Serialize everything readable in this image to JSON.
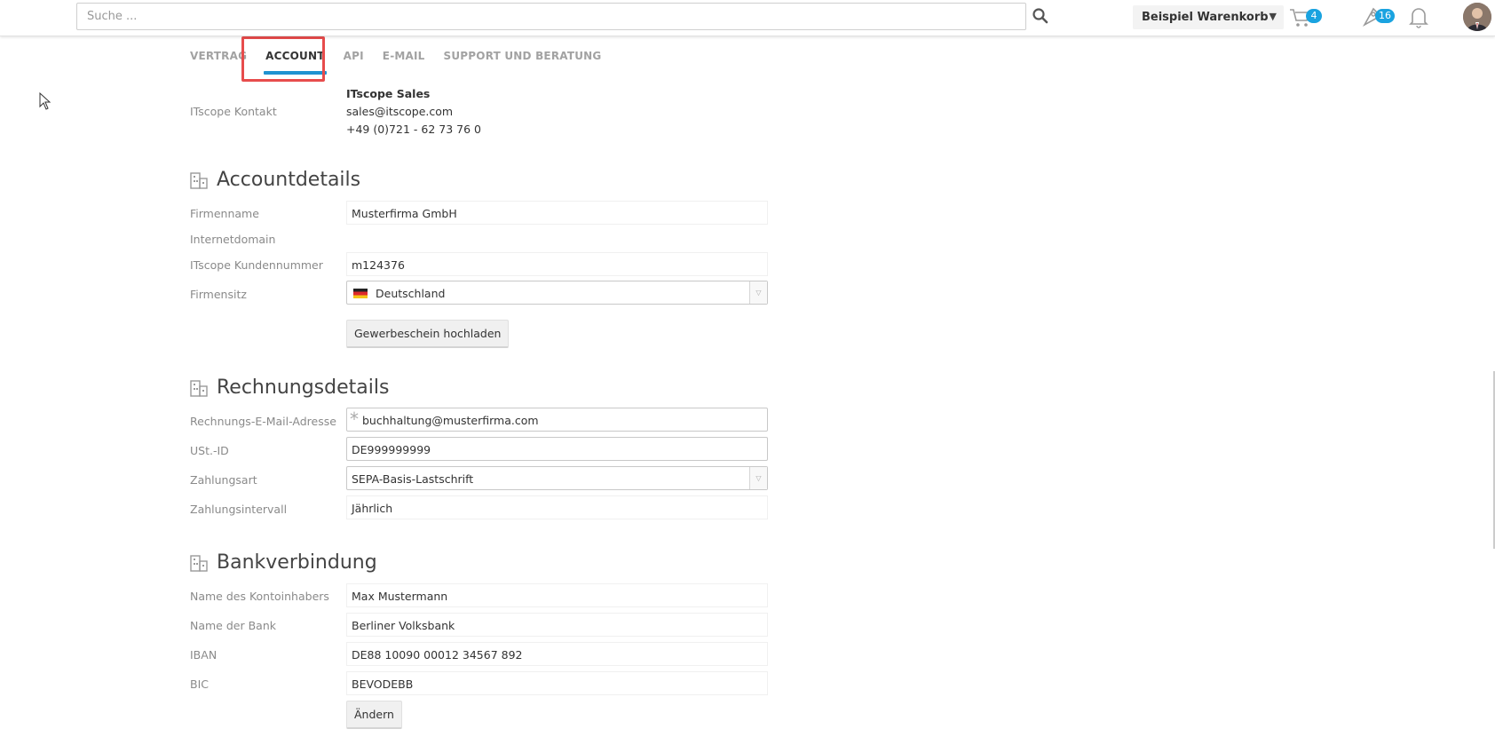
{
  "header": {
    "search_placeholder": "Suche ...",
    "cart_name": "Beispiel Warenkorb",
    "cart_count": "4",
    "watch_count": "16"
  },
  "tabs": [
    {
      "label": "VERTRAG"
    },
    {
      "label": "ACCOUNT"
    },
    {
      "label": "API"
    },
    {
      "label": "E-MAIL"
    },
    {
      "label": "SUPPORT UND BERATUNG"
    }
  ],
  "contact": {
    "label": "ITscope Kontakt",
    "name": "ITscope Sales",
    "email": "sales@itscope.com",
    "phone": "+49 (0)721 - 62 73 76 0"
  },
  "account": {
    "title": "Accountdetails",
    "company_label": "Firmenname",
    "company_value": "Musterfirma GmbH",
    "domain_label": "Internetdomain",
    "customer_no_label": "ITscope Kundennummer",
    "customer_no_value": "m124376",
    "seat_label": "Firmensitz",
    "seat_value": "Deutschland",
    "upload_button": "Gewerbeschein hochladen"
  },
  "billing": {
    "title": "Rechnungsdetails",
    "email_label": "Rechnungs-E-Mail-Adresse",
    "email_value": "buchhaltung@musterfirma.com",
    "vat_label": "USt.-ID",
    "vat_value": "DE999999999",
    "payment_label": "Zahlungsart",
    "payment_value": "SEPA-Basis-Lastschrift",
    "interval_label": "Zahlungsintervall",
    "interval_value": "Jährlich"
  },
  "bank": {
    "title": "Bankverbindung",
    "holder_label": "Name des Kontoinhabers",
    "holder_value": "Max Mustermann",
    "bank_label": "Name der Bank",
    "bank_value": "Berliner Volksbank",
    "iban_label": "IBAN",
    "iban_value": "DE88 10090 00012 34567 892",
    "bic_label": "BIC",
    "bic_value": "BEVODEBB",
    "change_button": "Ändern"
  },
  "colors": {
    "accent": "#1f93d1",
    "highlight": "#e74c4c",
    "badge": "#1aa3e0"
  }
}
